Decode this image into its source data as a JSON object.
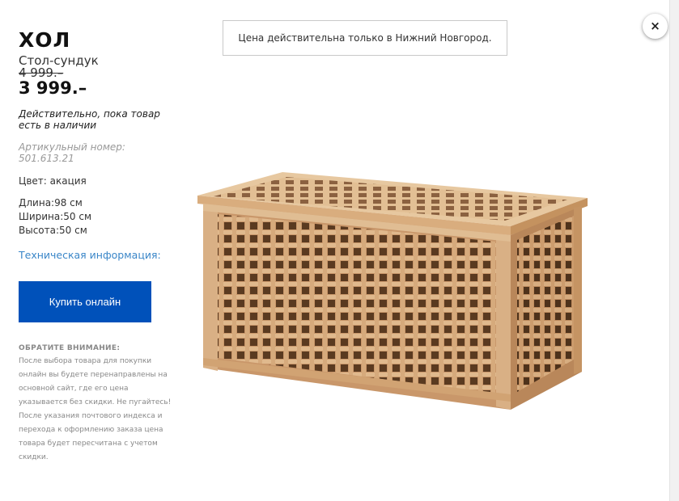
{
  "product": {
    "name": "ХОЛ",
    "type": "Стол-сундук",
    "old_price": "4 999.–",
    "new_price": "3 999.–",
    "validity": "Действительно, пока товар есть в наличии",
    "article_label": "Артикульный номер: 501.613.21",
    "color_label": "Цвет: акация",
    "dimensions": {
      "length": "Длина:98 см",
      "width": "Ширина:50 см",
      "height": "Высота:50 см"
    },
    "tech_link": "Техническая информация:",
    "buy_label": "Купить онлайн",
    "notice_title": "ОБРАТИТЕ ВНИМАНИЕ:",
    "notice_body": "После выбора товара для покупки онлайн вы будете перенаправлены на основной сайт, где его цена указывается без скидки. Не пугайтесь! После указания почтового индекса и перехода к оформлению заказа цена товара будет пересчитана с учетом скидки.",
    "image_icon": "wooden-lattice-chest-image"
  },
  "banner": {
    "text": "Цена действительна только в Нижний Новгород."
  },
  "close": {
    "label": "×",
    "icon": "close-icon"
  },
  "colors": {
    "buy_button": "#0051ba",
    "link": "#3a86c8",
    "wood_light": "#dcb38a",
    "wood_dark": "#b98757"
  }
}
